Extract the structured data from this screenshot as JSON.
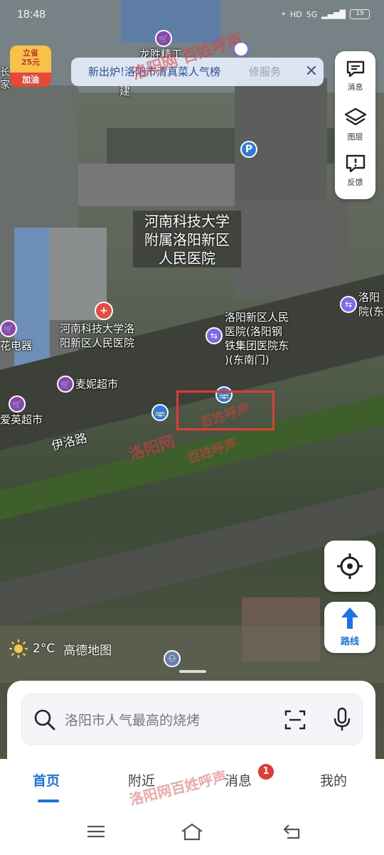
{
  "status_bar": {
    "time": "18:48",
    "signal": "5G",
    "hd": "HD",
    "battery": "19"
  },
  "promo": {
    "top_line1": "立省",
    "top_line2": "25元",
    "bottom": "加油"
  },
  "banner": {
    "text": "新出炉!洛阳市清真菜人气榜",
    "close": "✕"
  },
  "tools": [
    {
      "label": "消息",
      "icon": "message-icon"
    },
    {
      "label": "图层",
      "icon": "layers-icon"
    },
    {
      "label": "反馈",
      "icon": "feedback-icon"
    }
  ],
  "map_labels": {
    "hospital_line1": "河南科技大学",
    "hospital_line2": "附属洛阳新区",
    "hospital_line3": "人民医院",
    "poi_hospital_1": "河南科技大学洛",
    "poi_hospital_2": "阳新区人民医院",
    "poi_gate_1": "洛阳新区人民",
    "poi_gate_2": "医院(洛阳钢",
    "poi_gate_3": "铁集团医院东",
    "poi_gate_4": ")(东南门)",
    "poi_right_1": "洛阳",
    "poi_right_2": "院(东",
    "market": "麦妮超市",
    "electric": "花电器",
    "super2": "爱英超市",
    "road": "伊洛路",
    "top_shop": "龙胜精工",
    "top_char": "建",
    "top_left_1": "长",
    "top_left_2": "家",
    "partial_service": "修服务"
  },
  "watermarks": [
    "洛阳网 百姓呼声",
    "百姓呼声",
    "洛阳网",
    "百姓呼声"
  ],
  "weather": {
    "temp": "2°C",
    "brand": "高德地图"
  },
  "route_label": "路线",
  "search": {
    "placeholder": "洛阳市人气最高的烧烤"
  },
  "tabs": [
    {
      "label": "首页",
      "active": true
    },
    {
      "label": "附近",
      "active": false
    },
    {
      "label": "消息",
      "active": false
    },
    {
      "label": "我的",
      "active": false
    }
  ],
  "badge": "1",
  "bottom_watermark": "洛阳网百姓呼声"
}
